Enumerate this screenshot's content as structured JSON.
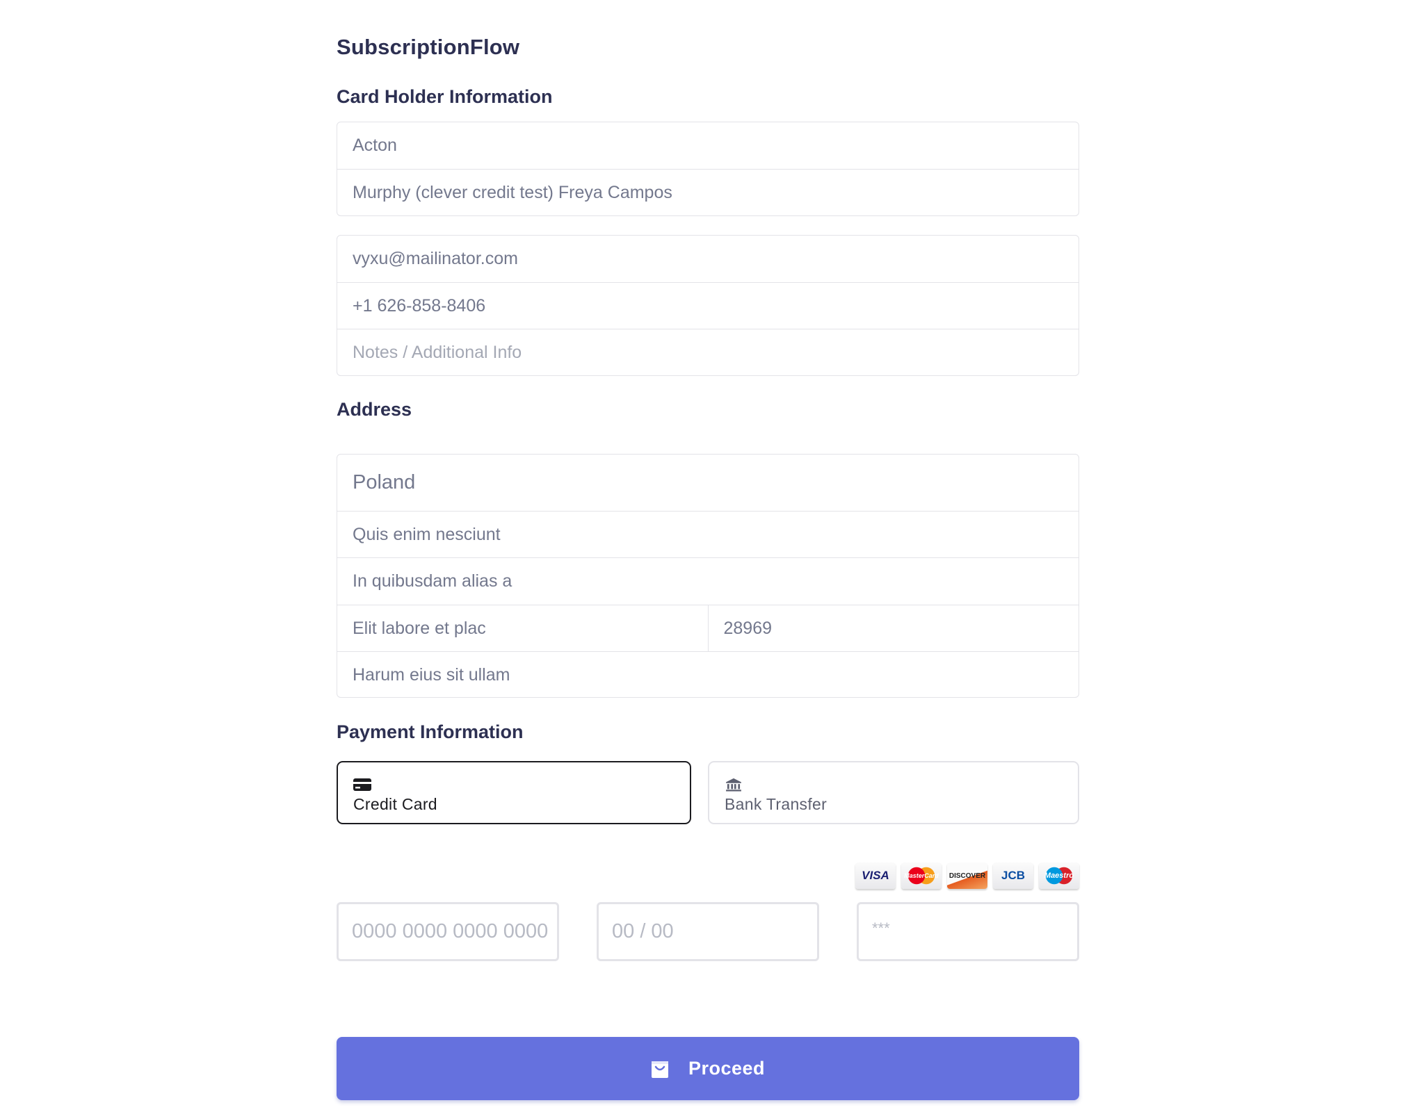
{
  "app": {
    "title": "SubscriptionFlow"
  },
  "card_holder": {
    "section_title": "Card Holder Information",
    "first_name": "Acton",
    "last_name": "Murphy (clever credit test) Freya Campos",
    "email": "vyxu@mailinator.com",
    "phone": "+1 626-858-8406",
    "notes_placeholder": "Notes / Additional Info"
  },
  "address": {
    "section_title": "Address",
    "country": "Poland",
    "line1": "Quis enim nesciunt",
    "line2": "In quibusdam alias a",
    "city": "Elit labore et plac",
    "zip": "28969",
    "state": "Harum eius sit ullam"
  },
  "payment": {
    "section_title": "Payment Information",
    "options": [
      {
        "label": "Credit Card",
        "icon": "credit-card-icon",
        "selected": true
      },
      {
        "label": "Bank Transfer",
        "icon": "bank-icon",
        "selected": false
      }
    ],
    "card_brands": [
      {
        "name": "VISA",
        "color": "#1a1f71"
      },
      {
        "name": "MasterCard",
        "color": "#eb001b"
      },
      {
        "name": "DISCOVER",
        "color": "#e55c20"
      },
      {
        "name": "JCB",
        "color": "#0b4ea2"
      },
      {
        "name": "Maestro",
        "color": "#0099df"
      }
    ],
    "card_number_placeholder": "0000 0000 0000 0000",
    "expiry_placeholder": "00 / 00",
    "cvc_placeholder": "***"
  },
  "actions": {
    "proceed_label": "Proceed",
    "proceed_icon": "shopping-bag-icon",
    "primary_color": "#6571de"
  }
}
